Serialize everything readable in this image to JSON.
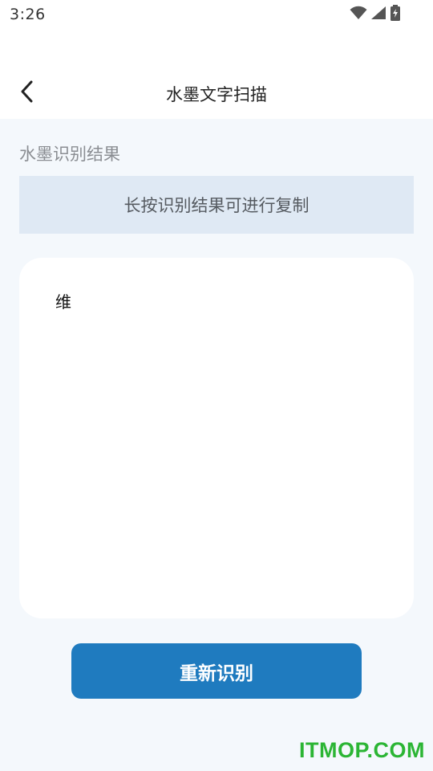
{
  "status_bar": {
    "time": "3:26",
    "icons": [
      "wifi-icon",
      "signal-icon",
      "battery-charging-icon"
    ]
  },
  "header": {
    "back_icon": "chevron-left-icon",
    "title": "水墨文字扫描"
  },
  "main": {
    "section_label": "水墨识别结果",
    "hint": "长按识别结果可进行复制",
    "result_text": "维",
    "retry_label": "重新识别"
  },
  "watermark": {
    "text": "ITMOP.COM"
  },
  "colors": {
    "accent": "#1f7bbf",
    "content_bg": "#f4f8fc",
    "hint_bg": "#dfe9f4",
    "watermark": "#2bb534"
  }
}
